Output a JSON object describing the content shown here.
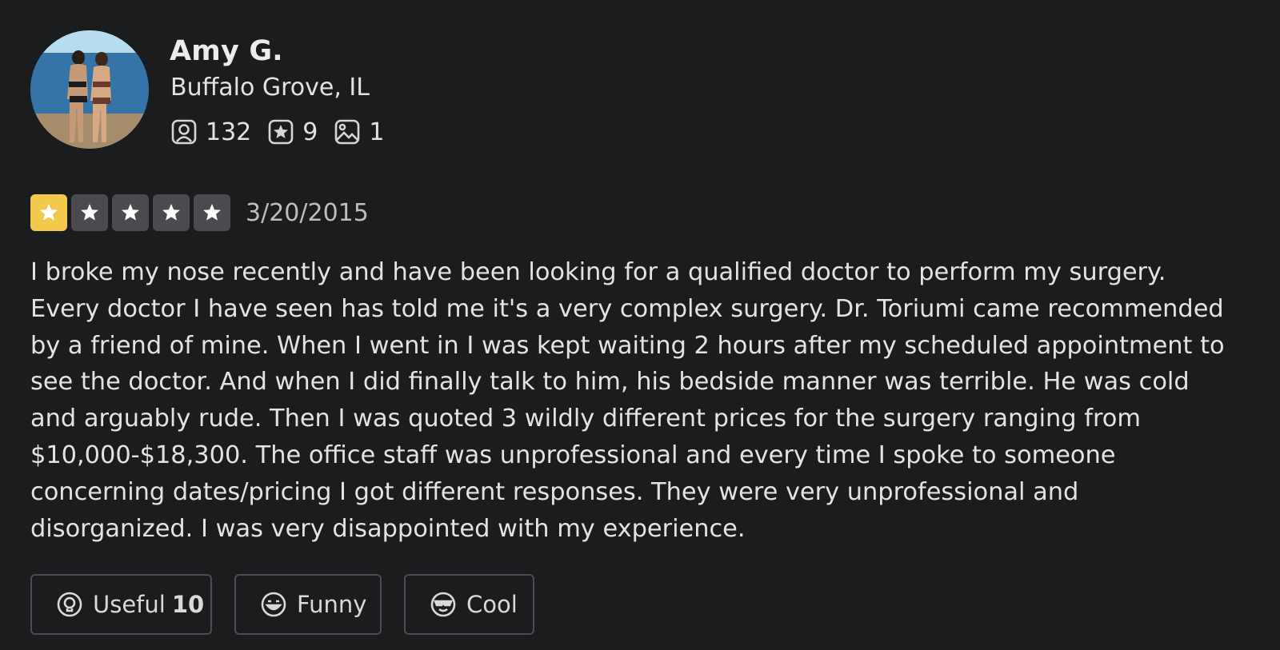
{
  "user": {
    "name": "Amy G.",
    "location": "Buffalo Grove, IL",
    "stats": {
      "friends": "132",
      "reviews": "9",
      "photos": "1"
    },
    "avatar_icon": "user-photo"
  },
  "review": {
    "rating": 1,
    "rating_max": 5,
    "date": "3/20/2015",
    "text": "I broke my nose recently and have been looking for a qualified doctor to perform my surgery. Every doctor I have seen has told me it's a very complex surgery. Dr. Toriumi came recommended by a friend of mine. When I went in I was kept waiting 2 hours after my scheduled appointment to see the doctor. And when I did finally talk to him, his bedside manner was terrible. He was cold and arguably rude. Then I was quoted 3 wildly different prices for the surgery ranging from $10,000-$18,300. The office staff was unprofessional and every time I spoke to someone concerning dates/pricing I got different responses. They were very unprofessional and disorganized. I was very disappointed with my experience."
  },
  "reactions": {
    "useful_label": "Useful",
    "useful_count": "10",
    "funny_label": "Funny",
    "cool_label": "Cool"
  },
  "colors": {
    "background": "#1b1c1e",
    "star_filled": "#f2c94c",
    "star_empty": "#4a4b4e",
    "border": "#4b4c4f"
  },
  "icons": {
    "friends": "friends-icon",
    "reviews": "review-star-icon",
    "photos": "photo-icon",
    "useful": "useful-bulb-icon",
    "funny": "funny-face-icon",
    "cool": "cool-sunglasses-icon"
  }
}
